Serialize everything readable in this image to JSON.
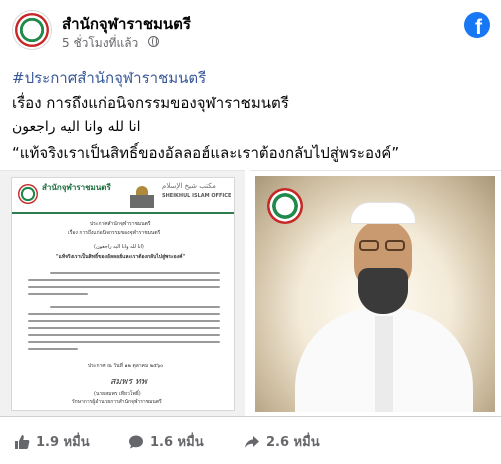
{
  "post": {
    "page_name": "สำนักจุฬาราชมนตรี",
    "time": "5 ชั่วโมงที่แล้ว",
    "hashtag": "#ประกาศสำนักจุฬาราชมนตรี",
    "subject": "เรื่อง การถึงแก่อนิจกรรมของจุฬาราชมนตรี",
    "arabic": "انا لله وانا اليه راجعون",
    "quote": "“แท้จริงเราเป็นสิทธิ์ของอัลลอฮ์และเราต้องกลับไปสู่พระองค์”"
  },
  "document": {
    "org_thai": "สำนักจุฬาราชมนตรี",
    "org_eng": "SHEIKHUL ISLAM OFFICE",
    "title_line1": "ประกาศสำนักจุฬาราชมนตรี",
    "title_line2": "เรื่อง การถึงแก่อนิจกรรมของจุฬาราชมนตรี",
    "arabic_line": "(انا لله وانا اليه راجعون)",
    "quote_line": "\"แท้จริงเราเป็นสิทธิ์ของอัลลอฮ์และเราต้องกลับไปสู่พระองค์\"",
    "date_line": "ประกาศ ณ วันที่ ๑๒ ตุลาคม ๒๕๖๐",
    "signer": "(นายสมพร เทียวโพธิ์)",
    "signer_title": "รักษาการผู้อำนวยการสำนักจุฬาราชมนตรี",
    "signature": "สมพร ทพ"
  },
  "stats": {
    "likes": "1.9 หมื่น",
    "comments": "1.6 หมื่น",
    "shares": "2.6 หมื่น"
  },
  "icons": {
    "fb": "facebook-logo",
    "like": "thumbs-up-icon",
    "comment": "comment-bubble-icon",
    "share": "share-arrow-icon"
  },
  "colors": {
    "brand_green": "#1f8a4c",
    "brand_red": "#c62828",
    "facebook_blue": "#1877f2",
    "hashtag": "#385898"
  }
}
